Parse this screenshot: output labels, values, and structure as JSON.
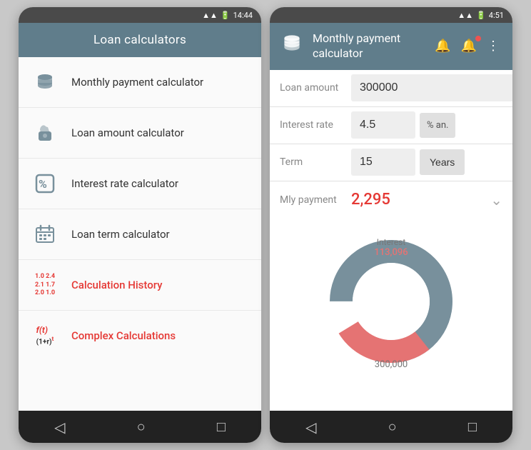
{
  "left_phone": {
    "status_bar": {
      "time": "14:44",
      "icons": "signal battery"
    },
    "header": {
      "title": "Loan calculators"
    },
    "menu_items": [
      {
        "id": "monthly-payment",
        "label": "Monthly payment calculator",
        "icon": "💰",
        "icon_type": "teal",
        "label_type": "normal"
      },
      {
        "id": "loan-amount",
        "label": "Loan amount calculator",
        "icon": "💼",
        "icon_type": "teal",
        "label_type": "normal"
      },
      {
        "id": "interest-rate",
        "label": "Interest rate calculator",
        "icon": "%",
        "icon_type": "teal",
        "label_type": "normal"
      },
      {
        "id": "loan-term",
        "label": "Loan term calculator",
        "icon": "📅",
        "icon_type": "teal",
        "label_type": "normal"
      },
      {
        "id": "calc-history",
        "label": "Calculation History",
        "icon": "hist",
        "icon_type": "red",
        "label_type": "red"
      },
      {
        "id": "complex-calc",
        "label": "Complex Calculations",
        "icon": "complex",
        "icon_type": "red",
        "label_type": "red"
      }
    ],
    "nav": {
      "back": "◁",
      "home": "○",
      "recents": "□"
    }
  },
  "right_phone": {
    "status_bar": {
      "time": "4:51",
      "icons": "signal battery"
    },
    "header": {
      "title": "Monthly payment\ncalculator",
      "icon": "💰",
      "action1": "🔔",
      "action2": "🔔",
      "action3": "⋮"
    },
    "fields": [
      {
        "label": "Loan amount",
        "value": "300000",
        "unit": null,
        "type": "amount"
      },
      {
        "label": "Interest rate",
        "value": "4.5",
        "unit": "% an.",
        "type": "rate"
      },
      {
        "label": "Term",
        "value": "15",
        "unit": "Years",
        "type": "term"
      }
    ],
    "result": {
      "label": "Mly payment",
      "value": "2,295"
    },
    "chart": {
      "interest_label": "Interest",
      "interest_value": "113,096",
      "principal_value": "300,000",
      "interest_color": "#e57373",
      "principal_color": "#78909c",
      "interest_percent": 27,
      "principal_percent": 73
    },
    "nav": {
      "back": "◁",
      "home": "○",
      "recents": "□"
    }
  }
}
